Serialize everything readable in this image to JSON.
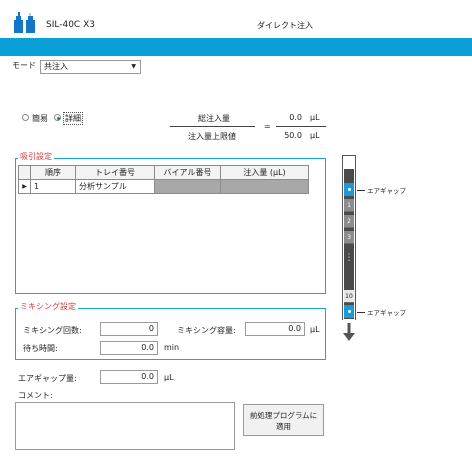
{
  "header": {
    "instrument": "SIL-40C X3",
    "title": "ダイレクト注入"
  },
  "mode": {
    "label": "モード",
    "value": "共注入"
  },
  "view_options": {
    "simple": "簡易",
    "detail": "詳細",
    "selected": "詳細"
  },
  "totals": {
    "total_label": "総注入量",
    "total_value": "0.0",
    "total_unit": "μL",
    "equals": "=",
    "limit_label": "注入量上限値",
    "limit_value": "50.0",
    "limit_unit": "μL"
  },
  "suction": {
    "title": "吸引設定",
    "columns": [
      "順序",
      "トレイ番号",
      "バイアル番号",
      "注入量 (μL)"
    ],
    "rows": [
      {
        "marker": "▶",
        "order": "1",
        "tray": "分析サンプル",
        "vial": "",
        "volume": ""
      }
    ]
  },
  "needle": {
    "top_label": "エアギャップ",
    "bottom_label": "エアギャップ",
    "segments": [
      "1",
      "2",
      "3",
      "10"
    ],
    "dots": "⋮"
  },
  "mixing": {
    "title": "ミキシング設定",
    "count_label": "ミキシング回数:",
    "count_value": "0",
    "volume_label": "ミキシング容量:",
    "volume_value": "0.0",
    "volume_unit": "μL",
    "wait_label": "待ち時間:",
    "wait_value": "0.0",
    "wait_unit": "min"
  },
  "air_gap": {
    "label": "エアギャップ量:",
    "value": "0.0",
    "unit": "μL"
  },
  "comment": {
    "label": "コメント:",
    "value": ""
  },
  "apply_button": {
    "line1": "前処理プログラムに",
    "line2": "適用"
  },
  "colors": {
    "accent": "#0aa0d7",
    "group_title": "#d23a3a",
    "needle_blue": "#1a9bd7"
  }
}
